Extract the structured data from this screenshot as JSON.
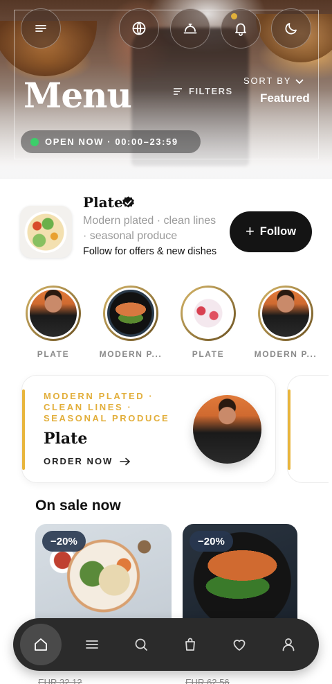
{
  "hero": {
    "title": "Menu",
    "filters_label": "FILTERS",
    "sort_label": "SORT BY",
    "sort_value": "Featured",
    "status": "OPEN NOW · 00:00–23:59",
    "top_buttons": [
      {
        "icon": "menu-icon"
      },
      {
        "icon": "globe-icon"
      },
      {
        "icon": "service-bell-icon"
      },
      {
        "icon": "bell-icon",
        "has_notification": true
      },
      {
        "icon": "moon-icon"
      }
    ]
  },
  "profile": {
    "name": "Plate",
    "verified": true,
    "description": "Modern plated · clean lines · seasonal produce",
    "cta_text": "Follow for offers & new dishes",
    "follow_label": "Follow"
  },
  "stories": [
    {
      "label": "PLATE"
    },
    {
      "label": "MODERN P..."
    },
    {
      "label": "PLATE"
    },
    {
      "label": "MODERN P..."
    }
  ],
  "promo": {
    "tags": "MODERN PLATED · CLEAN LINES · SEASONAL PRODUCE",
    "title": "Plate",
    "cta": "ORDER NOW"
  },
  "sale": {
    "heading": "On sale now",
    "items": [
      {
        "discount": "−20%",
        "old_price": "EUR 32.12"
      },
      {
        "discount": "−20%",
        "old_price": "EUR 62.56"
      }
    ]
  },
  "bottom_nav": [
    {
      "icon": "home-icon",
      "active": true
    },
    {
      "icon": "menu-icon",
      "active": false
    },
    {
      "icon": "search-icon",
      "active": false
    },
    {
      "icon": "bag-icon",
      "active": false
    },
    {
      "icon": "heart-icon",
      "active": false
    },
    {
      "icon": "user-icon",
      "active": false
    }
  ],
  "colors": {
    "accent_gold": "#e2ae3a",
    "open_green": "#3ccf6a",
    "follow_bg": "#141414",
    "nav_bg": "#2b2b2b"
  }
}
